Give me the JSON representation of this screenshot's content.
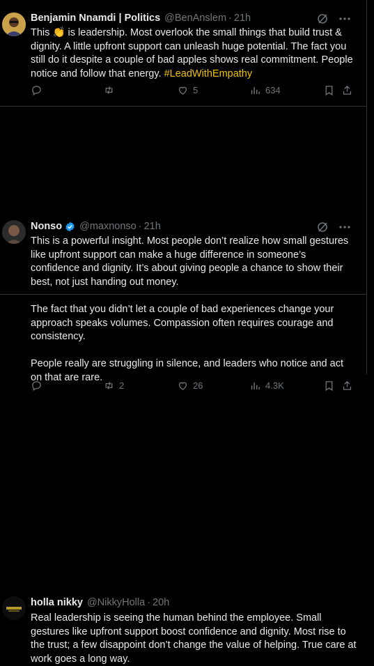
{
  "tweets": [
    {
      "name": "Benjamin Nnamdi | Politics",
      "handle": "@BenAnslem",
      "time": "21h",
      "text_before": "This",
      "emoji": "👏",
      "text_after": "is leadership. Most overlook the small things that build trust & dignity. A little upfront support can unleash huge potential. The fact you still do it despite a couple of bad apples shows real commitment. People notice and follow that energy.",
      "hashtag": "#LeadWithEmpathy",
      "replies": "",
      "reposts": "",
      "likes": "5",
      "views": "634"
    },
    {
      "name": "Nonso",
      "handle": "@maxnonso",
      "time": "21h",
      "paragraphs": [
        "This is a powerful insight. Most people don’t realize how small gestures like upfront support can make a huge difference in someone’s confidence and dignity. It’s about giving people a chance to show their best, not just handing out money.",
        "The fact that you didn’t let a couple of bad experiences change your approach speaks volumes. Compassion often requires courage and consistency.",
        "People really are struggling in silence, and leaders who notice and act on that are rare."
      ],
      "replies": "",
      "reposts": "2",
      "likes": "26",
      "views": "4.3K"
    },
    {
      "name": "holla nikky",
      "handle": "@NikkyHolla",
      "time": "20h",
      "text": "Real leadership is seeing the human behind the employee. Small gestures like upfront support boost confidence and dignity. Most rise to the trust; a few disappoint don’t change the value of helping. True care at work goes a long way."
    }
  ],
  "separator": "·",
  "colors": {
    "background": "#000000",
    "text": "#e7e9ea",
    "muted": "#71767b",
    "hashtag": "#f0c400",
    "verified": "#1d9bf0",
    "divider": "#2f3336"
  },
  "icons": [
    "grok-icon",
    "more-icon",
    "reply-icon",
    "repost-icon",
    "like-icon",
    "views-icon",
    "bookmark-icon",
    "share-icon",
    "verified-badge-icon"
  ]
}
